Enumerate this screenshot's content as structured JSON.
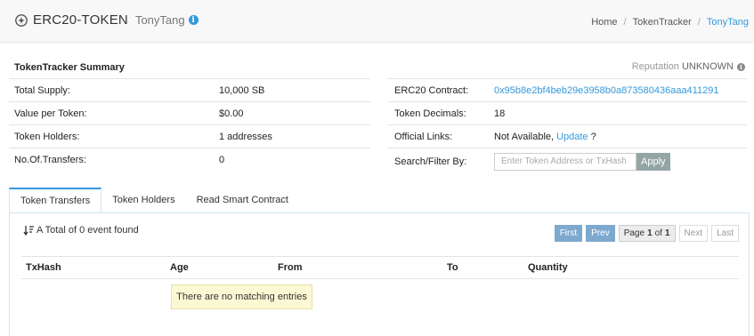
{
  "header": {
    "brand_icon": "token-icon",
    "title": "ERC20-TOKEN",
    "token_name": "TonyTang",
    "info_icon": "info-icon",
    "breadcrumb": [
      "Home",
      "TokenTracker",
      "TonyTang"
    ]
  },
  "summary": {
    "title": "TokenTracker Summary",
    "reputation_label": "Reputation",
    "reputation_value": "UNKNOWN",
    "left_rows": [
      {
        "label": "Total Supply:",
        "value": "10,000 SB"
      },
      {
        "label": "Value per Token:",
        "value": "$0.00"
      },
      {
        "label": "Token Holders:",
        "value": "1 addresses"
      },
      {
        "label": "No.Of.Transfers:",
        "value": "0"
      }
    ],
    "right_rows": {
      "contract_label": "ERC20 Contract:",
      "contract_value": "0x95b8e2bf4beb29e3958b0a873580436aaa411291",
      "decimals_label": "Token Decimals:",
      "decimals_value": "18",
      "links_label": "Official Links:",
      "links_text": "Not Available,",
      "links_update": "Update",
      "links_suffix": "?",
      "search_label": "Search/Filter By:",
      "search_placeholder": "Enter Token Address or TxHash",
      "apply_label": "Apply"
    }
  },
  "tabs": [
    "Token Transfers",
    "Token Holders",
    "Read Smart Contract"
  ],
  "transfers": {
    "total_text": "A Total of 0 event found",
    "sort_icon": "sort-icon",
    "pager": {
      "first": "First",
      "prev": "Prev",
      "page_word": "Page",
      "page": "1",
      "of_word": "of",
      "pages": "1",
      "next": "Next",
      "last": "Last"
    },
    "columns": [
      "TxHash",
      "Age",
      "From",
      "To",
      "Quantity"
    ],
    "empty_message": "There are no matching entries"
  },
  "colors": {
    "accent": "#3498db",
    "pager_active": "#7ea9cf",
    "empty_bg": "#fcf8d4"
  }
}
